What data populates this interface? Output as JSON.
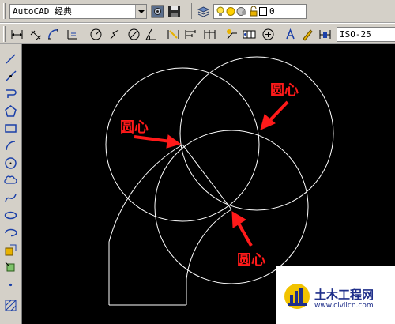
{
  "toolbar": {
    "workspace_value": "AutoCAD 经典",
    "layer_value": "0",
    "dimstyle_value": "ISO-25"
  },
  "annotations": {
    "center_label_1": "圆心",
    "center_label_2": "圆心",
    "center_label_3": "圆心"
  },
  "watermark": {
    "title": "土木工程网",
    "url": "www.civilcn.com"
  },
  "colors": {
    "canvas_bg": "#000000",
    "geometry": "#ffffff",
    "annotation": "#ff1a1a",
    "watermark_text": "#1f2f8a"
  },
  "left_tools": [
    "line-icon",
    "construction-line-icon",
    "polyline-icon",
    "polygon-icon",
    "rectangle-icon",
    "arc-icon",
    "circle-icon",
    "revision-cloud-icon",
    "spline-icon",
    "ellipse-icon",
    "ellipse-arc-icon",
    "insert-block-icon",
    "make-block-icon",
    "point-icon",
    "hatch-icon"
  ]
}
